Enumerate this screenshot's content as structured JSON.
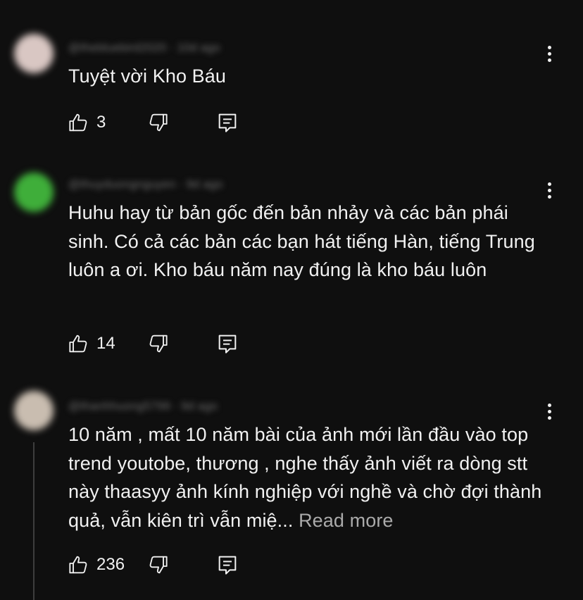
{
  "comments": [
    {
      "author": "@thebluebird2020",
      "time": "10d ago",
      "avatar_color": "#d9c7c3",
      "text": "Tuyệt vời Kho Báu",
      "read_more": "",
      "likes": "3"
    },
    {
      "author": "@thuyduongnguyen",
      "time": "9d ago",
      "avatar_color": "#3fae3a",
      "text": "Huhu hay từ bản gốc đến bản nhảy và các bản phái sinh. Có cả các bản các bạn hát tiếng Hàn, tiếng Trung luôn a ơi. Kho báu năm nay đúng là kho báu luôn",
      "read_more": "",
      "likes": "14"
    },
    {
      "author": "@thanhhuong5799",
      "time": "9d ago",
      "avatar_color": "#c9bdb0",
      "text": "10 năm , mất 10 năm bài của ảnh mới lần đầu vào top trend  youtobe, thương , nghe thấy ảnh viết ra dòng stt này thaasyy ảnh kính nghiệp với nghề và chờ đợi thành quả, vẫn kiên trì vẫn miệ...",
      "read_more": "Read more",
      "likes": "236"
    }
  ],
  "icons": {
    "like": "thumb-up-icon",
    "dislike": "thumb-down-icon",
    "reply": "reply-comment-icon",
    "more": "more-vertical-icon"
  }
}
